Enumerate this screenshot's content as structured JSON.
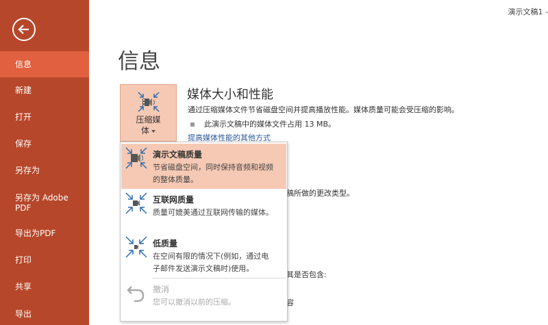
{
  "window": {
    "doc_title": "演示文稿1 -"
  },
  "sidebar": {
    "items": [
      {
        "label": "信息"
      },
      {
        "label": "新建"
      },
      {
        "label": "打开"
      },
      {
        "label": "保存"
      },
      {
        "label": "另存为"
      },
      {
        "label": "另存为 Adobe PDF"
      },
      {
        "label": "导出为PDF"
      },
      {
        "label": "打印"
      },
      {
        "label": "共享"
      },
      {
        "label": "导出"
      }
    ]
  },
  "main": {
    "page_title": "信息",
    "compress_button": {
      "line1": "压缩媒",
      "line2": "体"
    },
    "section": {
      "heading": "媒体大小和性能",
      "description": "通过压缩媒体文件节省磁盘空间并提高播放性能。媒体质量可能会受压缩的影响。",
      "bullet": "此演示文稿中的媒体文件占用 13 MB。",
      "link": "提高媒体性能的其他方式"
    },
    "partial_texts": {
      "changes": "稿所做的更改类型。",
      "contains": "其是否包含:",
      "content": "容"
    }
  },
  "dropdown": {
    "items": [
      {
        "title": "演示文稿质量",
        "desc": "节省磁盘空间，同时保持音频和视频的整体质量。"
      },
      {
        "title": "互联网质量",
        "desc": "质量可媲美通过互联网传输的媒体。"
      },
      {
        "title": "低质量",
        "desc": "在空间有限的情况下(例如，通过电子邮件发送演示文稿时)使用。"
      },
      {
        "title": "撤消",
        "desc": "您可以撤消以前的压缩。"
      }
    ]
  },
  "colors": {
    "accent": "#b7472a",
    "active_nav": "#e0603f",
    "highlight": "#f6c9b4",
    "link": "#2b579a",
    "icon_blue": "#2b6cb0"
  }
}
